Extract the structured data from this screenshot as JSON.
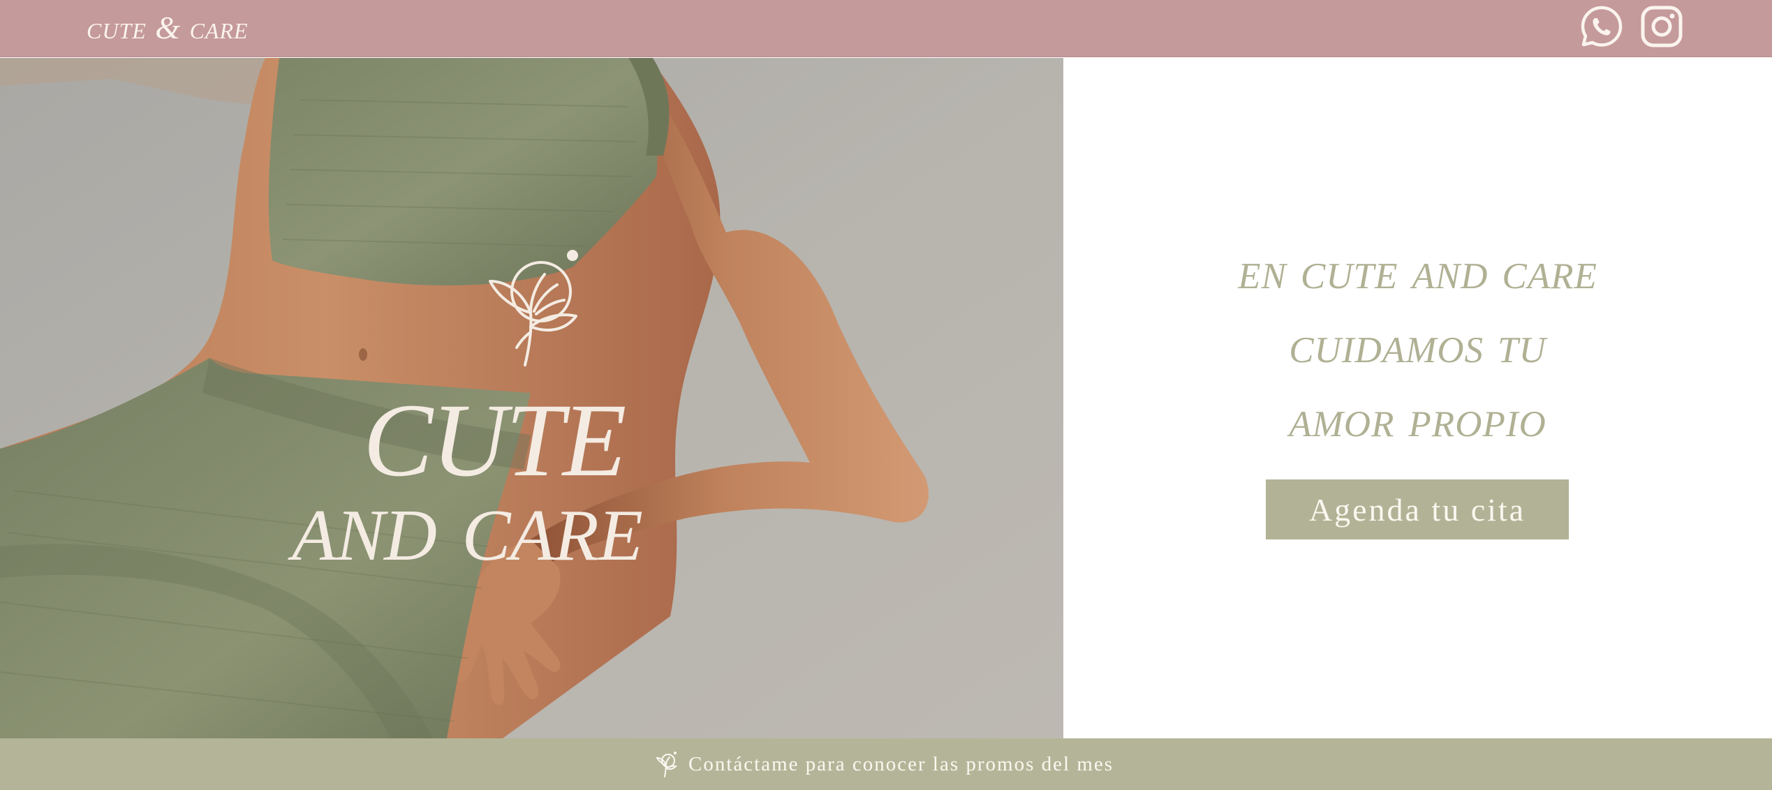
{
  "header": {
    "brand": "cute & care",
    "whatsapp_icon": "whatsapp-icon",
    "instagram_icon": "instagram-icon",
    "background": "#c59a9b"
  },
  "hero": {
    "logo_line1": "cute",
    "logo_line2": "and care",
    "logo_icon": "flower-icon",
    "slogan_line1": "en cute and care",
    "slogan_line2": "cuidamos tu",
    "slogan_line3": "amor propio",
    "cta_label": "Agenda tu cita",
    "accent": "#b2b396"
  },
  "footer": {
    "promo_text": "Contáctame para conocer las promos del mes",
    "promo_icon": "flower-icon",
    "background": "#b4b598"
  }
}
